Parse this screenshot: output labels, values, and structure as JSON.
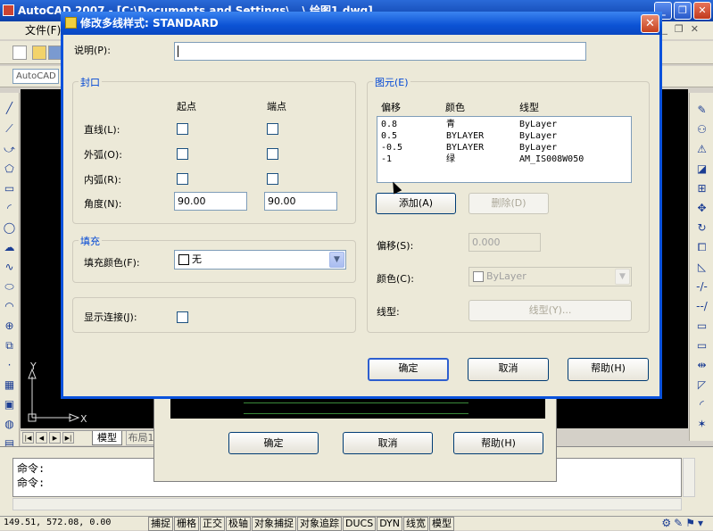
{
  "app": {
    "title": "AutoCAD 2007 - [C:\\Documents and Settings\\...\\ 绘图1.dwg]",
    "menu": [
      "文件(F)"
    ]
  },
  "workspace": {
    "combo": "AutoCAD"
  },
  "layout_tabs": {
    "model": "模型",
    "layout": "布局1"
  },
  "ucs": {
    "x": "X",
    "y": "Y"
  },
  "command": {
    "lines": [
      "命令:",
      "命令:"
    ]
  },
  "status_bar": {
    "coords": "149.51, 572.08, 0.00",
    "toggles": [
      "捕捉",
      "栅格",
      "正交",
      "极轴",
      "对象捕捉",
      "对象追踪",
      "DUCS",
      "DYN",
      "线宽",
      "模型"
    ]
  },
  "back_dialog": {
    "buttons": [
      "确定",
      "取消",
      "帮助(H)"
    ]
  },
  "dialog": {
    "title": "修改多线样式:  STANDARD",
    "description_label": "说明(P):",
    "description_value": "",
    "caps": {
      "group_title": "封口",
      "col_start": "起点",
      "col_end": "端点",
      "line_label": "直线(L):",
      "outer_arc_label": "外弧(O):",
      "inner_arc_label": "内弧(R):",
      "angle_label": "角度(N):",
      "angle_start": "90.00",
      "angle_end": "90.00"
    },
    "fill": {
      "group_title": "填充",
      "color_label": "填充颜色(F):",
      "color_value": "无"
    },
    "joints_label": "显示连接(J):",
    "elements": {
      "group_title": "图元(E)",
      "headers": [
        "偏移",
        "颜色",
        "线型"
      ],
      "rows": [
        {
          "offset": "0.8",
          "color": "青",
          "linetype": "ByLayer"
        },
        {
          "offset": "0.5",
          "color": "BYLAYER",
          "linetype": "ByLayer"
        },
        {
          "offset": "-0.5",
          "color": "BYLAYER",
          "linetype": "ByLayer"
        },
        {
          "offset": "-1",
          "color": "绿",
          "linetype": "AM_IS008W050"
        }
      ],
      "add_button": "添加(A)",
      "delete_button": "删除(D)",
      "offset_label": "偏移(S):",
      "offset_value": "0.000",
      "color_label": "颜色(C):",
      "color_value": "ByLayer",
      "linetype_label": "线型:",
      "linetype_button": "线型(Y)..."
    },
    "buttons": {
      "ok": "确定",
      "cancel": "取消",
      "help": "帮助(H)"
    }
  },
  "colors": {
    "title_blue": "#0b52d4",
    "group_title": "#0046d5",
    "face": "#ece9d8"
  }
}
